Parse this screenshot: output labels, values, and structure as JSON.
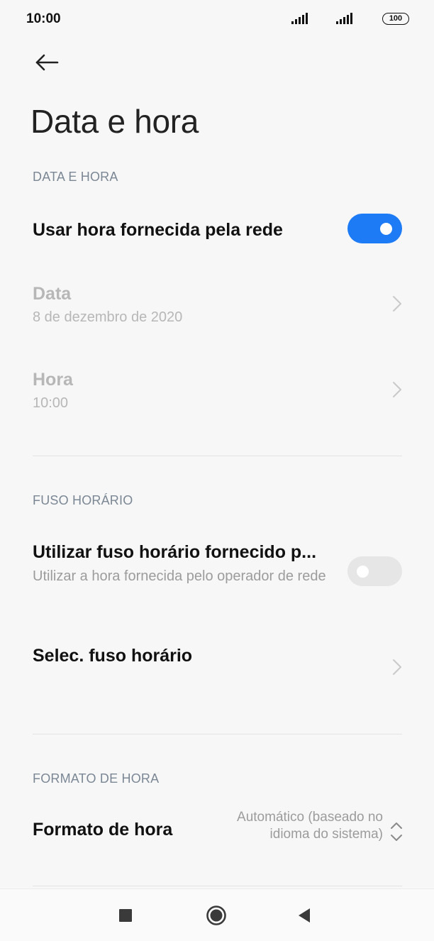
{
  "status_bar": {
    "time": "10:00",
    "battery": "100",
    "icons": [
      "signal-icon",
      "signal-icon",
      "battery-icon"
    ]
  },
  "header": {
    "back_icon": "arrow-left-icon",
    "title": "Data e hora"
  },
  "sections": {
    "date_time": {
      "header": "DATA E HORA",
      "network_time": {
        "label": "Usar hora fornecida pela rede",
        "enabled": true
      },
      "date": {
        "label": "Data",
        "value": "8 de dezembro de 2020"
      },
      "time": {
        "label": "Hora",
        "value": "10:00"
      }
    },
    "timezone": {
      "header": "FUSO HORÁRIO",
      "network_timezone": {
        "label": "Utilizar fuso horário fornecido p...",
        "description": "Utilizar a hora fornecida pelo operador de rede",
        "enabled": false
      },
      "select_timezone": {
        "label": "Selec. fuso horário"
      }
    },
    "time_format": {
      "header": "FORMATO DE HORA",
      "format": {
        "label": "Formato de hora",
        "value": "Automático (baseado no idioma do sistema)"
      }
    }
  },
  "colors": {
    "accent": "#1c7bf5",
    "background": "#f7f7f7",
    "section_header": "#7b8794",
    "disabled_text": "#b7b7b7"
  },
  "nav_bar": {
    "icons": [
      "recents-square-icon",
      "home-circle-icon",
      "back-triangle-icon"
    ]
  }
}
